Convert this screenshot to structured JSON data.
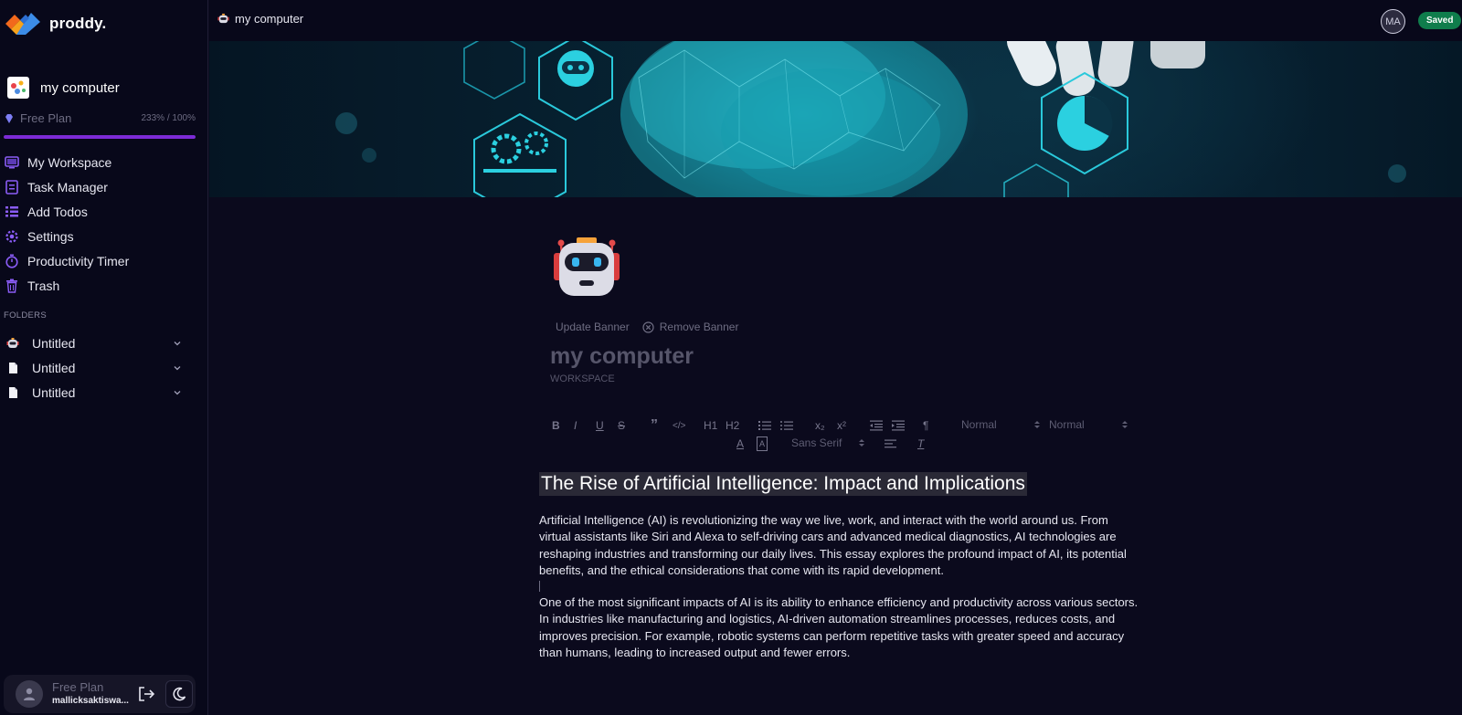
{
  "brand": {
    "name": "proddy."
  },
  "sidebar": {
    "workspace_name": "my computer",
    "plan_label": "Free Plan",
    "plan_usage": "233% / 100%",
    "plan_progress_percent": 100,
    "nav": [
      {
        "label": "My Workspace",
        "icon": "workspace-icon"
      },
      {
        "label": "Task Manager",
        "icon": "task-manager-icon"
      },
      {
        "label": "Add Todos",
        "icon": "todo-list-icon"
      },
      {
        "label": "Settings",
        "icon": "gear-icon"
      },
      {
        "label": "Productivity Timer",
        "icon": "timer-icon"
      },
      {
        "label": "Trash",
        "icon": "trash-icon"
      }
    ],
    "folders_label": "FOLDERS",
    "folders": [
      {
        "label": "Untitled",
        "icon": "robot-icon"
      },
      {
        "label": "Untitled",
        "icon": "document-icon"
      },
      {
        "label": "Untitled",
        "icon": "document-icon"
      }
    ],
    "user": {
      "plan": "Free Plan",
      "email": "mallicksaktiswa..."
    }
  },
  "topbar": {
    "breadcrumb": "my computer",
    "avatar_initials": "MA",
    "status": "Saved"
  },
  "document": {
    "update_banner": "Update Banner",
    "remove_banner": "Remove Banner",
    "title": "my computer",
    "subtitle": "WORKSPACE",
    "toolbar": {
      "bold": "B",
      "italic": "I",
      "underline": "U",
      "strike": "S",
      "quote": "”",
      "code": "</>",
      "h1": "H1",
      "h2": "H2",
      "sub": "x₂",
      "sup": "x²",
      "rtl": "¶",
      "size_select": "Normal",
      "header_select": "Normal",
      "font_select": "Sans Serif",
      "color": "A",
      "background": "A",
      "clear": "T"
    },
    "heading": "The Rise of Artificial Intelligence: Impact and Implications",
    "paragraphs": [
      "Artificial Intelligence (AI) is revolutionizing the way we live, work, and interact with the world around us. From virtual assistants like Siri and Alexa to self-driving cars and advanced medical diagnostics, AI technologies are reshaping industries and transforming our daily lives. This essay explores the profound impact of AI, its potential benefits, and the ethical considerations that come with its rapid development.",
      "One of the most significant impacts of AI is its ability to enhance efficiency and productivity across various sectors. In industries like manufacturing and logistics, AI-driven automation streamlines processes, reduces costs, and improves precision. For example, robotic systems can perform repetitive tasks with greater speed and accuracy than humans, leading to increased output and fewer errors."
    ]
  },
  "colors": {
    "background": "#0b0a1d",
    "sidebar": "#08081a",
    "accent_purple": "#7c2bd6",
    "saved_green": "#0f7d4c"
  }
}
